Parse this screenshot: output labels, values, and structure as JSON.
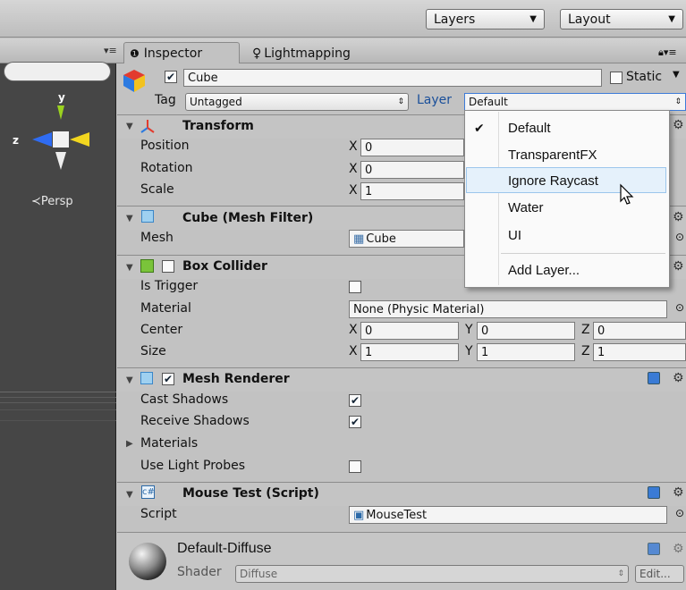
{
  "toolbar": {
    "layers_label": "Layers",
    "layout_label": "Layout"
  },
  "scene": {
    "persp_label": "≺Persp",
    "axis_y": "y",
    "axis_z": "z"
  },
  "tabs": [
    {
      "label": "Inspector"
    },
    {
      "label": "Lightmapping"
    }
  ],
  "object": {
    "name": "Cube",
    "static_label": "Static",
    "tag_label": "Tag",
    "tag_value": "Untagged",
    "layer_label": "Layer",
    "layer_value": "Default"
  },
  "transform": {
    "title": "Transform",
    "props": [
      "Position",
      "Rotation",
      "Scale"
    ],
    "x_values": [
      "0",
      "0",
      "1"
    ]
  },
  "mesh_filter": {
    "title": "Cube (Mesh Filter)",
    "mesh_label": "Mesh",
    "mesh_value": "Cube"
  },
  "box_collider": {
    "title": "Box Collider",
    "is_trigger": "Is Trigger",
    "material": "Material",
    "material_value": "None (Physic Material)",
    "center": "Center",
    "size": "Size",
    "center_vals": [
      "0",
      "0",
      "0"
    ],
    "size_vals": [
      "1",
      "1",
      "1"
    ]
  },
  "mesh_renderer": {
    "title": "Mesh Renderer",
    "cast_shadows": "Cast Shadows",
    "receive_shadows": "Receive Shadows",
    "materials": "Materials",
    "use_light_probes": "Use Light Probes"
  },
  "mouse_test": {
    "title": "Mouse Test (Script)",
    "script_label": "Script",
    "script_value": "MouseTest"
  },
  "material": {
    "name": "Default-Diffuse",
    "shader_label": "Shader",
    "shader_value": "Diffuse",
    "edit_label": "Edit..."
  },
  "layer_menu": {
    "items": [
      "Default",
      "TransparentFX",
      "Ignore Raycast",
      "Water",
      "UI"
    ],
    "add_layer": "Add Layer..."
  }
}
